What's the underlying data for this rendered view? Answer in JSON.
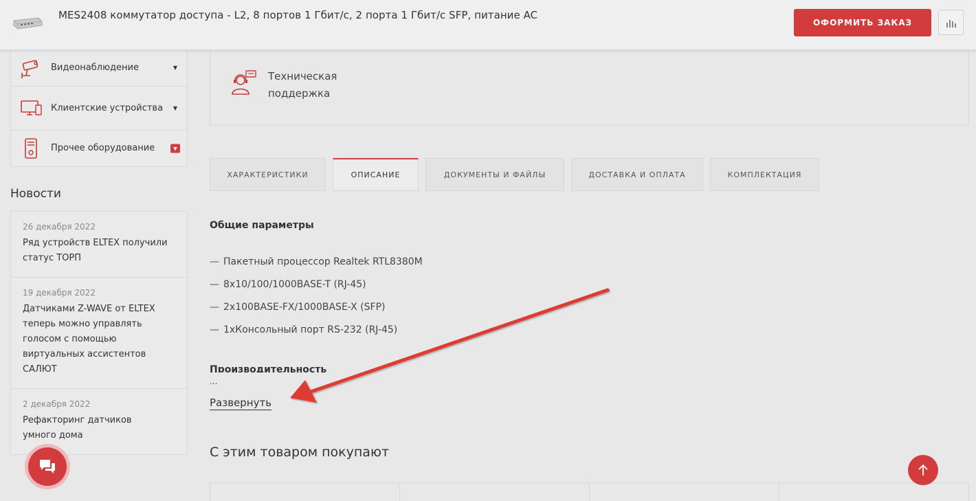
{
  "header": {
    "product_title": "MES2408 коммутатор доступа - L2, 8 портов 1 Гбит/с, 2 порта 1 Гбит/с SFP, питание AC",
    "order_button": "ОФОРМИТЬ ЗАКАЗ",
    "compare_icon": "bar-chart-icon"
  },
  "sidebar": {
    "items": [
      {
        "label": "Видеонаблюдение",
        "icon": "cctv-camera-icon"
      },
      {
        "label": "Клиентские устройства",
        "icon": "monitor-icon"
      },
      {
        "label": "Прочее оборудование",
        "icon": "server-tower-icon"
      }
    ]
  },
  "news": {
    "title": "Новости",
    "items": [
      {
        "date": "26 декабря 2022",
        "text": "Ряд устройств ELTEX получили статус ТОРП"
      },
      {
        "date": "19 декабря 2022",
        "text": "Датчиками Z-WAVE от ELTEX теперь можно управлять голосом с помощью виртуальных ассистентов САЛЮТ"
      },
      {
        "date": "2 декабря 2022",
        "text": "Рефакторинг датчиков умного дома"
      }
    ]
  },
  "support": {
    "label": "Техническая поддержка",
    "icon": "support-agent-icon"
  },
  "tabs": [
    {
      "label": "ХАРАКТЕРИСТИКИ",
      "active": false
    },
    {
      "label": "ОПИСАНИЕ",
      "active": true
    },
    {
      "label": "ДОКУМЕНТЫ И ФАЙЛЫ",
      "active": false
    },
    {
      "label": "ДОСТАВКА И ОПЛАТА",
      "active": false
    },
    {
      "label": "КОМПЛЕКТАЦИЯ",
      "active": false
    }
  ],
  "description": {
    "heading": "Общие параметры",
    "items": [
      "Пакетный процессор Realtek RTL8380M",
      "8x10/100/1000BASE-T (RJ-45)",
      "2x100BASE-FX/1000BASE-X (SFP)",
      "1xКонсольный порт RS-232 (RJ-45)"
    ],
    "heading2": "Производительность",
    "ellipsis": "...",
    "expand_link": "Развернуть"
  },
  "related": {
    "heading": "С этим товаром покупают"
  },
  "colors": {
    "accent": "#d23c3c",
    "background": "#e8e8e8"
  }
}
